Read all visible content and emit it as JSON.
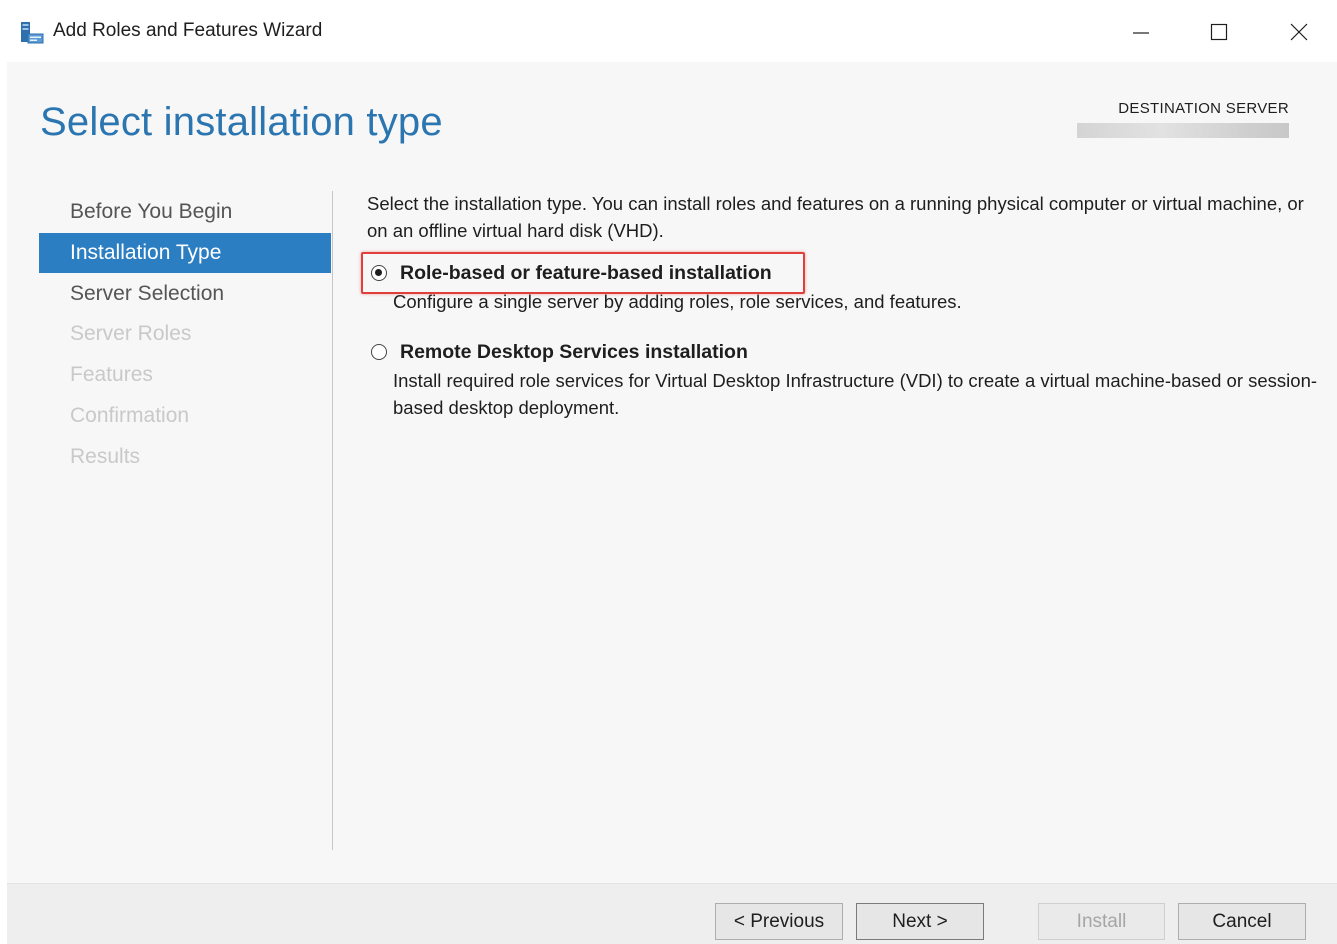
{
  "window": {
    "title": "Add Roles and Features Wizard"
  },
  "header": {
    "page_title": "Select installation type",
    "destination_label": "DESTINATION SERVER"
  },
  "nav": {
    "items": [
      {
        "label": "Before You Begin",
        "state": "normal"
      },
      {
        "label": "Installation Type",
        "state": "active"
      },
      {
        "label": "Server Selection",
        "state": "normal"
      },
      {
        "label": "Server Roles",
        "state": "disabled"
      },
      {
        "label": "Features",
        "state": "disabled"
      },
      {
        "label": "Confirmation",
        "state": "disabled"
      },
      {
        "label": "Results",
        "state": "disabled"
      }
    ]
  },
  "content": {
    "intro": "Select the installation type. You can install roles and features on a running physical computer or virtual machine, or on an offline virtual hard disk (VHD).",
    "options": [
      {
        "label": "Role-based or feature-based installation",
        "description": "Configure a single server by adding roles, role services, and features.",
        "selected": true
      },
      {
        "label": "Remote Desktop Services installation",
        "description": "Install required role services for Virtual Desktop Infrastructure (VDI) to create a virtual machine-based or session-based desktop deployment.",
        "selected": false
      }
    ]
  },
  "footer": {
    "previous_label": "< Previous",
    "next_label": "Next >",
    "install_label": "Install",
    "cancel_label": "Cancel"
  },
  "colors": {
    "accent": "#2b7ec1",
    "title_blue": "#2b75b0",
    "highlight_red": "#e0403c"
  },
  "icons": {
    "app": "server-manager-icon",
    "minimize": "minimize-icon",
    "maximize": "maximize-icon",
    "close": "close-icon"
  }
}
